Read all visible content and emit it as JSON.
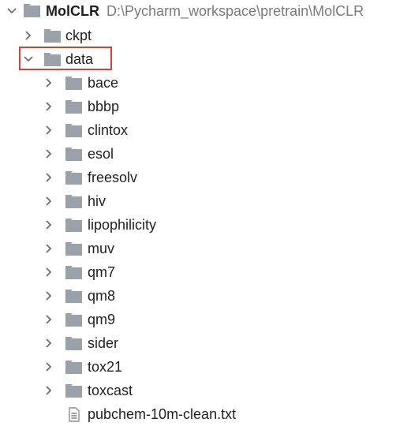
{
  "root": {
    "name": "MolCLR",
    "path": "D:\\Pycharm_workspace\\pretrain\\MolCLR",
    "expanded": true
  },
  "level1": [
    {
      "label": "ckpt",
      "expanded": false
    },
    {
      "label": "data",
      "expanded": true,
      "highlighted": true
    }
  ],
  "data_children": [
    {
      "label": "bace"
    },
    {
      "label": "bbbp"
    },
    {
      "label": "clintox"
    },
    {
      "label": "esol"
    },
    {
      "label": "freesolv"
    },
    {
      "label": "hiv"
    },
    {
      "label": "lipophilicity"
    },
    {
      "label": "muv"
    },
    {
      "label": "qm7"
    },
    {
      "label": "qm8"
    },
    {
      "label": "qm9"
    },
    {
      "label": "sider"
    },
    {
      "label": "tox21"
    },
    {
      "label": "toxcast"
    }
  ],
  "data_file": {
    "label": "pubchem-10m-clean.txt",
    "icon": "text-file-icon"
  },
  "colors": {
    "folder": "#9aa1a8",
    "arrow": "#6e6e6e",
    "highlight_border": "#e03a3a",
    "path_text": "#7a7a7a"
  }
}
